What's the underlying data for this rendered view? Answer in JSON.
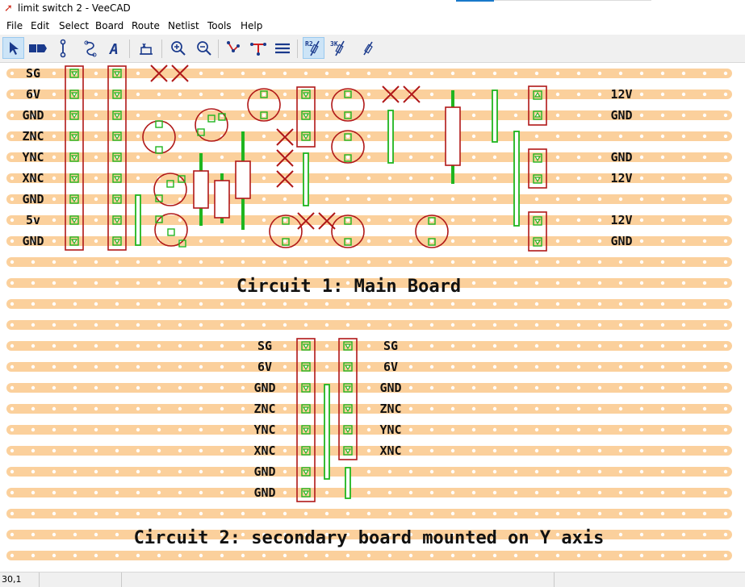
{
  "window": {
    "title": "limit switch 2 - VeeCAD"
  },
  "menu": [
    "File",
    "Edit",
    "Select",
    "Board",
    "Route",
    "Netlist",
    "Tools",
    "Help"
  ],
  "toolbar": [
    {
      "name": "select-tool",
      "icon": "arrow-pointer-icon"
    },
    {
      "name": "component-tool",
      "icon": "component-icon"
    },
    {
      "name": "link-tool",
      "icon": "link-icon"
    },
    {
      "name": "wire-tool",
      "icon": "wire-icon"
    },
    {
      "name": "text-tool",
      "icon": "text-A-icon"
    },
    {
      "name": "break-tool",
      "icon": "break-icon"
    },
    {
      "name": "zoom-in-tool",
      "icon": "zoom-in-icon"
    },
    {
      "name": "zoom-out-tool",
      "icon": "zoom-out-icon"
    },
    {
      "name": "net-trace-tool",
      "icon": "net-trace-icon"
    },
    {
      "name": "connectivity-tool",
      "icon": "connectivity-icon"
    },
    {
      "name": "strips-tool",
      "icon": "strips-icon"
    },
    {
      "name": "resistor-tool",
      "icon": "resistor-icon",
      "label": "R2"
    },
    {
      "name": "resistor-3k-tool",
      "icon": "resistor-icon",
      "label": "3K"
    },
    {
      "name": "pen-tool",
      "icon": "pen-icon"
    }
  ],
  "board": {
    "colors": {
      "strip": "#fbd09c",
      "hole": "#ffffff",
      "outline": "#b01818",
      "link": "#1fb51f",
      "break": "#b01818",
      "text": "#111111"
    },
    "left_labels": [
      "SG",
      "6V",
      "GND",
      "ZNC",
      "YNC",
      "XNC",
      "GND",
      "5v",
      "GND"
    ],
    "right_labels": [
      {
        "row": 1,
        "text": "12V"
      },
      {
        "row": 2,
        "text": "GND"
      },
      {
        "row": 4,
        "text": "GND"
      },
      {
        "row": 5,
        "text": "12V"
      },
      {
        "row": 7,
        "text": "12V"
      },
      {
        "row": 8,
        "text": "GND"
      }
    ],
    "circuit1_title": "Circuit 1: Main Board",
    "sec_left_labels": [
      "SG",
      "6V",
      "GND",
      "ZNC",
      "YNC",
      "XNC",
      "GND",
      "GND"
    ],
    "sec_right_labels": [
      "SG",
      "6V",
      "GND",
      "ZNC",
      "YNC",
      "XNC"
    ],
    "circuit2_title": "Circuit 2: secondary board mounted on Y axis"
  },
  "status": {
    "coords": "30,1"
  }
}
